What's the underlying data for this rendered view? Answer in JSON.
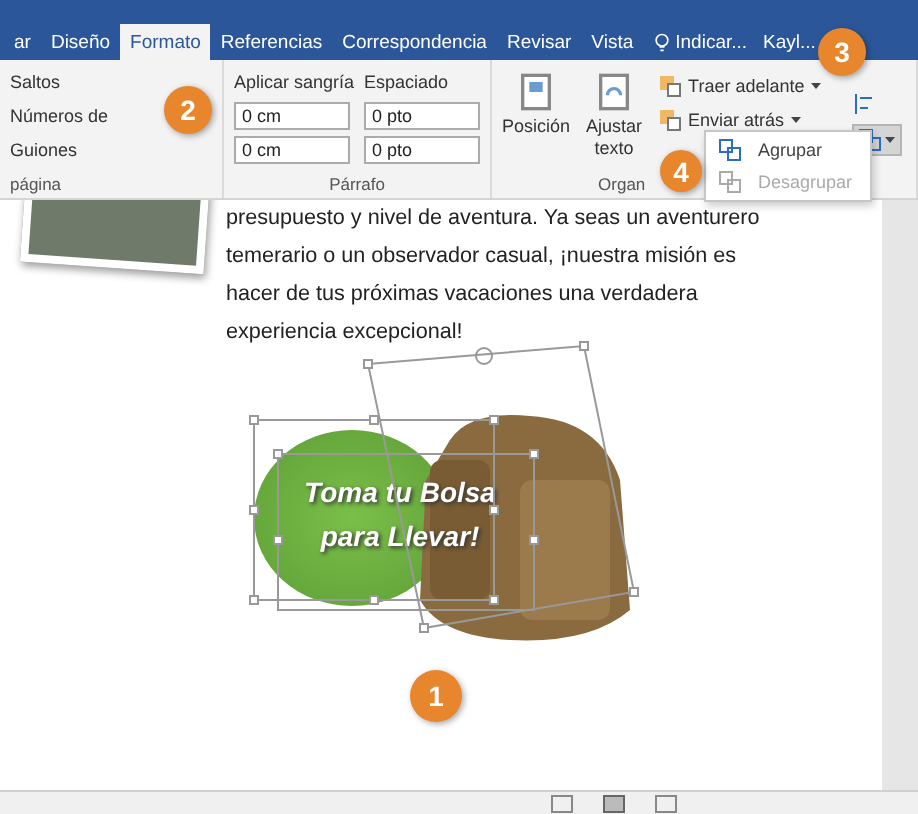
{
  "tabs": [
    {
      "label": "ar",
      "selected": false
    },
    {
      "label": "Diseño",
      "selected": false
    },
    {
      "label": "Formato",
      "selected": true
    },
    {
      "label": "Referencias",
      "selected": false
    },
    {
      "label": "Correspondencia",
      "selected": false
    },
    {
      "label": "Revisar",
      "selected": false
    },
    {
      "label": "Vista",
      "selected": false
    }
  ],
  "tell_me": "Indicar...",
  "user": "Kayl...",
  "page_group": {
    "label": "página",
    "items": [
      "Saltos",
      "Números de",
      "Guiones"
    ]
  },
  "paragraph_group": {
    "label": "Párrafo",
    "indent_label": "Aplicar sangría",
    "spacing_label": "Espaciado",
    "indent_left": "0 cm",
    "indent_right": "0 cm",
    "spacing_before": "0 pto",
    "spacing_after": "0 pto"
  },
  "arrange_group": {
    "label": "Organ",
    "position": "Posición",
    "wrap": [
      "Ajustar",
      "texto"
    ],
    "bring_forward": "Traer adelante",
    "send_backward": "Enviar atrás"
  },
  "group_menu": [
    {
      "label": "Agrupar",
      "disabled": false
    },
    {
      "label": "Desagrupar",
      "disabled": true
    }
  ],
  "paragraph": [
    "presupuesto y nivel de aventura. Ya seas un aventurero",
    "temerario o un observador casual, ¡nuestra misión es",
    "hacer de tus próximas vacaciones una verdadera",
    "experiencia excepcional!"
  ],
  "graphic_text": [
    "Toma tu Bolsa",
    "para Llevar!"
  ],
  "callouts": [
    "1",
    "2",
    "3",
    "4"
  ]
}
